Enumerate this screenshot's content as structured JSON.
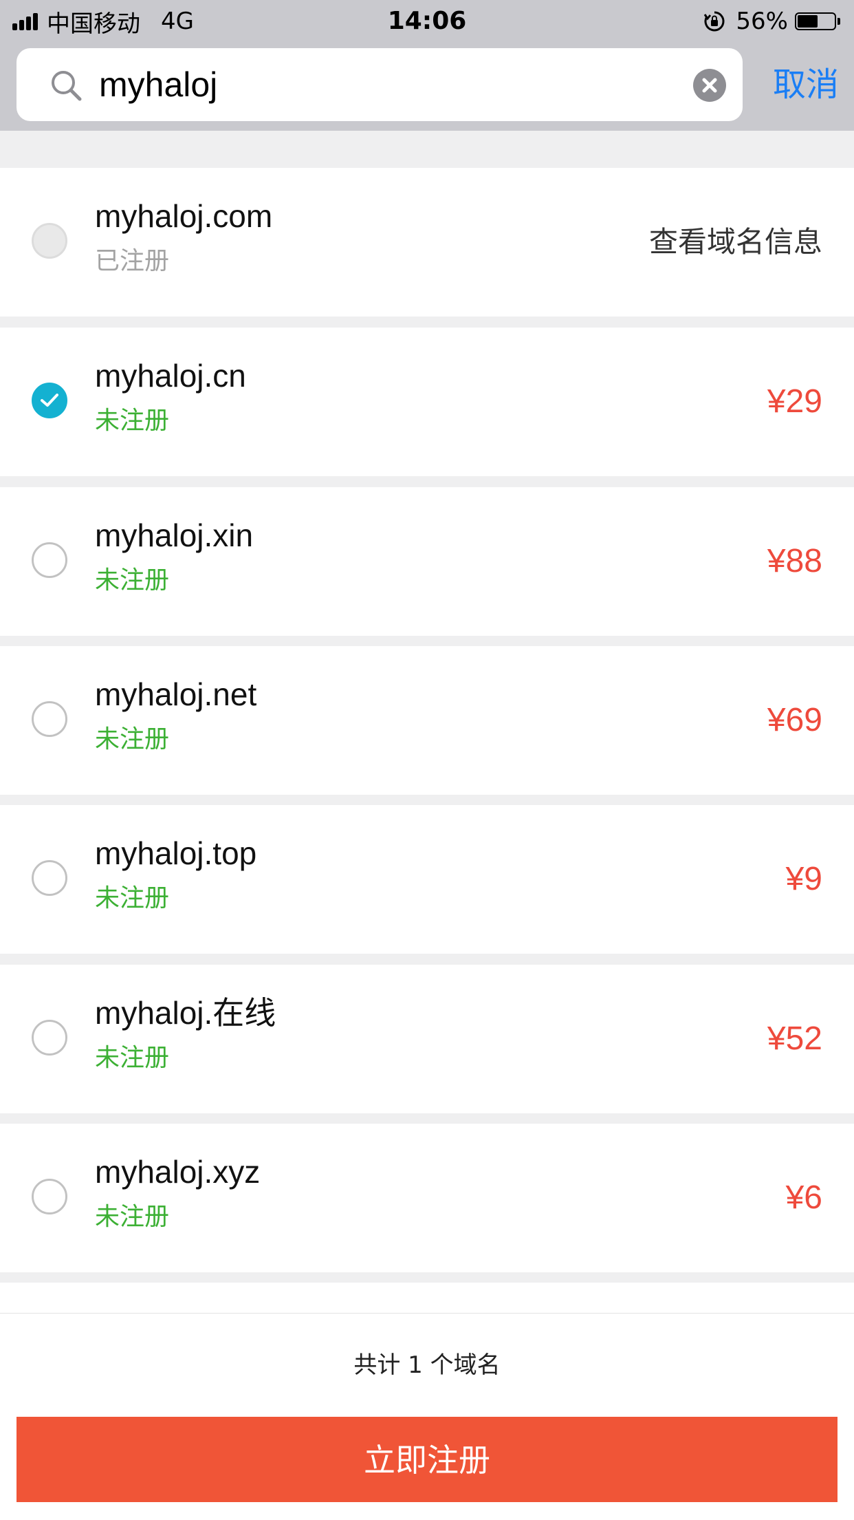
{
  "status_bar": {
    "carrier": "中国移动",
    "network": "4G",
    "time": "14:06",
    "battery_text": "56%",
    "battery_level": 0.56
  },
  "search": {
    "value": "myhaloj",
    "cancel_label": "取消"
  },
  "colors": {
    "accent_blue": "#1a7ef5",
    "check_blue": "#14b1d1",
    "price_red": "#ee4a3c",
    "available_green": "#3cb034",
    "button_orange": "#f05537"
  },
  "domains": [
    {
      "name": "myhaloj.com",
      "status": "已注册",
      "action": "查看域名信息",
      "state": "registered"
    },
    {
      "name": "myhaloj.cn",
      "status": "未注册",
      "price": "¥29",
      "state": "checked"
    },
    {
      "name": "myhaloj.xin",
      "status": "未注册",
      "price": "¥88",
      "state": "unchecked"
    },
    {
      "name": "myhaloj.net",
      "status": "未注册",
      "price": "¥69",
      "state": "unchecked"
    },
    {
      "name": "myhaloj.top",
      "status": "未注册",
      "price": "¥9",
      "state": "unchecked"
    },
    {
      "name": "myhaloj.在线",
      "status": "未注册",
      "price": "¥52",
      "state": "unchecked"
    },
    {
      "name": "myhaloj.xyz",
      "status": "未注册",
      "price": "¥6",
      "state": "unchecked"
    }
  ],
  "footer": {
    "total_text": "共计 1 个域名",
    "register_label": "立即注册"
  }
}
